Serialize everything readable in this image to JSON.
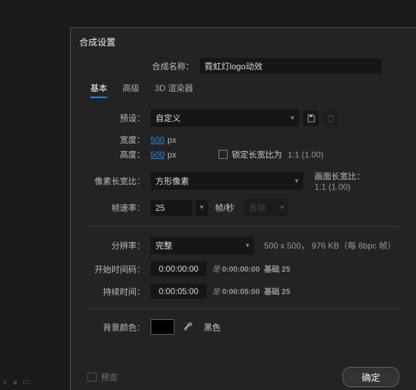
{
  "dialog": {
    "title": "合成设置"
  },
  "name": {
    "label": "合成名称：",
    "value": "霓虹灯logo动效"
  },
  "tabs": {
    "basic": "基本",
    "advanced": "高级",
    "renderer": "3D 渲染器"
  },
  "preset": {
    "label": "预设：",
    "value": "自定义"
  },
  "width": {
    "label": "宽度：",
    "value": "500",
    "unit": "px"
  },
  "height": {
    "label": "高度：",
    "value": "500",
    "unit": "px"
  },
  "lock": {
    "label": "锁定长宽比为",
    "ratio": "1:1 (1.00)"
  },
  "par": {
    "label": "像素长宽比：",
    "value": "方形像素"
  },
  "far": {
    "label": "画面长宽比：",
    "value": "1:1 (1.00)"
  },
  "fps": {
    "label": "帧速率：",
    "value": "25",
    "unit": "帧/秒",
    "drop": "丢帧"
  },
  "res": {
    "label": "分辨率：",
    "value": "完整",
    "info": "500 x 500， 976 KB（每 8bpc 帧）"
  },
  "start": {
    "label": "开始时间码：",
    "value": "0:00:00:00",
    "hint_prefix": "是",
    "hint_val": "0:00:00:00",
    "hint_base": "基础 25"
  },
  "dur": {
    "label": "持续时间：",
    "value": "0:00:05:00",
    "hint_prefix": "是",
    "hint_val": "0:00:05:00",
    "hint_base": "基础 25"
  },
  "bg": {
    "label": "背景颜色：",
    "name": "黑色"
  },
  "footer": {
    "preview": "预览",
    "ok": "确定"
  }
}
